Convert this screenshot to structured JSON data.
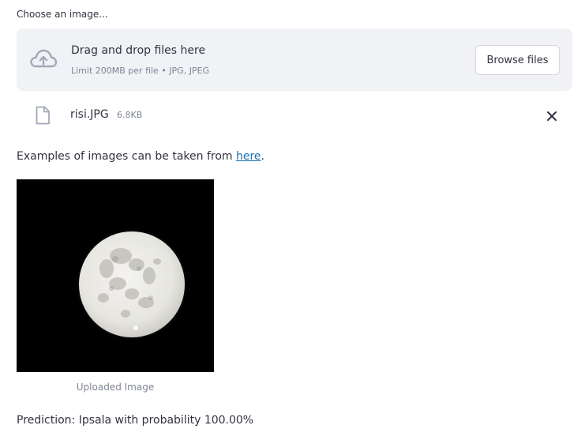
{
  "uploader": {
    "label": "Choose an image...",
    "dropzone_title": "Drag and drop files here",
    "dropzone_limit": "Limit 200MB per file • JPG, JPEG",
    "browse_label": "Browse files",
    "cloud_icon": "cloud-upload-icon"
  },
  "uploaded_file": {
    "name": "risi.JPG",
    "size": "6.8KB",
    "file_icon": "file-icon",
    "remove_icon": "close-icon"
  },
  "examples": {
    "prefix": "Examples of images can be taken from ",
    "link_text": "here",
    "suffix": "."
  },
  "image": {
    "caption": "Uploaded Image"
  },
  "prediction": {
    "text": "Prediction: Ipsala with probability 100.00%"
  },
  "colors": {
    "dropzone_bg": "#f0f2f6",
    "text": "#31333f",
    "muted": "#808495",
    "link": "#1c6fb2"
  }
}
